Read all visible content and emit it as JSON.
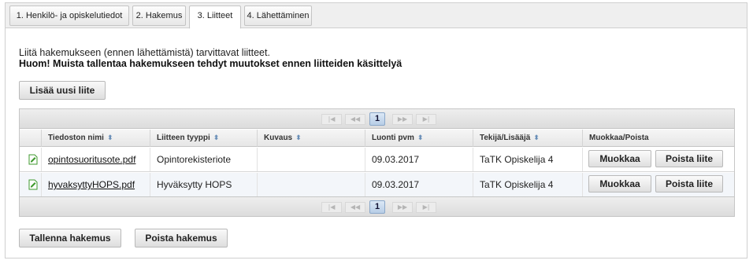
{
  "tabs": [
    {
      "label": "1. Henkilö- ja opiskelutiedot",
      "active": false
    },
    {
      "label": "2. Hakemus",
      "active": false
    },
    {
      "label": "3. Liitteet",
      "active": true
    },
    {
      "label": "4. Lähettäminen",
      "active": false
    }
  ],
  "intro": {
    "line1": "Liitä hakemukseen (ennen lähettämistä) tarvittavat liitteet.",
    "line2": "Huom! Muista tallentaa hakemukseen tehdyt muutokset ennen liitteiden käsittelyä"
  },
  "add_button": "Lisää uusi liite",
  "pager": {
    "first": "|◀",
    "prev": "◀◀",
    "current_page": "1",
    "next": "▶▶",
    "last": "▶|"
  },
  "columns": [
    "Tiedoston nimi",
    "Liitteen tyyppi",
    "Kuvaus",
    "Luonti pvm",
    "Tekijä/Lisääjä",
    "Muokkaa/Poista"
  ],
  "rows": [
    {
      "file": "opintosuoritusote.pdf",
      "type": "Opintorekisteriote",
      "description": "",
      "created": "09.03.2017",
      "author": "TaTK Opiskelija 4",
      "edit": "Muokkaa",
      "delete": "Poista liite"
    },
    {
      "file": "hyvaksyttyHOPS.pdf",
      "type": "Hyväksytty HOPS",
      "description": "",
      "created": "09.03.2017",
      "author": "TaTK Opiskelija 4",
      "edit": "Muokkaa",
      "delete": "Poista liite"
    }
  ],
  "footer": {
    "save": "Tallenna hakemus",
    "delete": "Poista hakemus"
  },
  "colors": {
    "file_icon": "#3f9a2e",
    "sort_icon": "#6a8fb8",
    "pager_active": "#b7cde6"
  },
  "icons": {
    "file": "document-edit-icon",
    "sort": "sort-updown-icon"
  }
}
